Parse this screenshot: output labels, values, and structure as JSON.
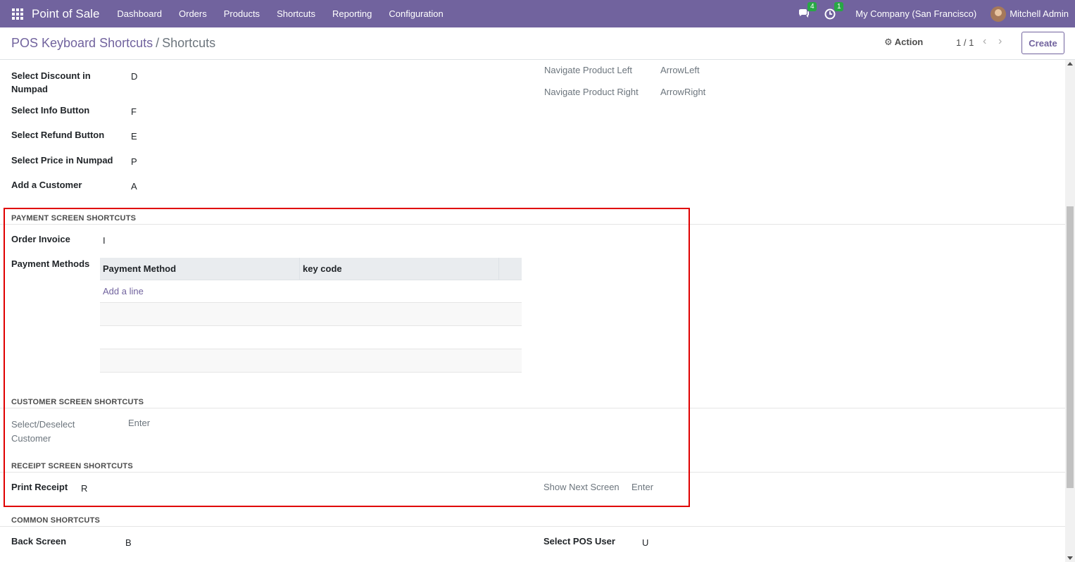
{
  "navbar": {
    "brand": "Point of Sale",
    "menu": [
      "Dashboard",
      "Orders",
      "Products",
      "Shortcuts",
      "Reporting",
      "Configuration"
    ],
    "messages_count": "4",
    "activities_count": "1",
    "company": "My Company (San Francisco)",
    "user": "Mitchell Admin"
  },
  "control_panel": {
    "breadcrumb_parent": "POS Keyboard Shortcuts",
    "breadcrumb_sep": "/",
    "breadcrumb_current": "Shortcuts",
    "action_label": "Action",
    "pager": "1 / 1",
    "create_label": "Create"
  },
  "top_fields_left": [
    {
      "label": "Select Discount in Numpad",
      "value": "D"
    },
    {
      "label": "Select Info Button",
      "value": "F"
    },
    {
      "label": "Select Refund Button",
      "value": "E"
    },
    {
      "label": "Select Price in Numpad",
      "value": "P"
    },
    {
      "label": "Add a Customer",
      "value": "A"
    }
  ],
  "top_fields_right": [
    {
      "label": "Navigate Product Left",
      "value": "ArrowLeft"
    },
    {
      "label": "Navigate Product Right",
      "value": "ArrowRight"
    }
  ],
  "payment_section": {
    "title": "PAYMENT SCREEN SHORTCUTS",
    "order_invoice_label": "Order Invoice",
    "order_invoice_value": "I",
    "payment_methods_label": "Payment Methods",
    "table_headers": [
      "Payment Method",
      "key code"
    ],
    "add_line": "Add a line"
  },
  "customer_section": {
    "title": "CUSTOMER SCREEN SHORTCUTS",
    "label": "Select/Deselect Customer",
    "value": "Enter"
  },
  "receipt_section": {
    "title": "RECEIPT SCREEN SHORTCUTS",
    "print_label": "Print Receipt",
    "print_value": "R",
    "next_label": "Show Next Screen",
    "next_value": "Enter"
  },
  "common_section": {
    "title": "COMMON SHORTCUTS",
    "back_label": "Back Screen",
    "back_value": "B",
    "user_label": "Select POS User",
    "user_value": "U"
  },
  "colors": {
    "navbar": "#71639e",
    "highlight": "#e00000",
    "badge": "#28a745"
  }
}
